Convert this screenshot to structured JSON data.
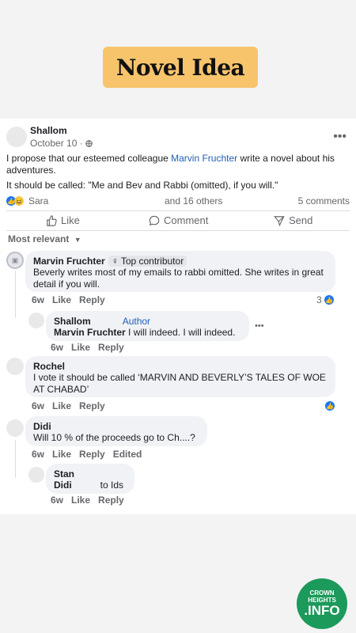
{
  "banner": {
    "title": "Novel Idea"
  },
  "post": {
    "author": "Shallom",
    "date": "October 10 · ",
    "text_before_link": "I propose that our esteemed colleague ",
    "link_name": "Marvin Fruchter",
    "text_after_link": " write a novel about his adventures.",
    "text_line2": "It should be called: \"Me and Bev and Rabbi (omitted), if you will.\"",
    "reactions_name": "Sara",
    "reactions_others": "and 16 others",
    "comments_count": "5 comments"
  },
  "actions": {
    "like": "Like",
    "comment": "Comment",
    "send": "Send"
  },
  "sort_label": "Most relevant",
  "comments": [
    {
      "name": "Marvin Fruchter",
      "badge": "Top contributor",
      "text": "Beverly writes most of my emails to rabbi omitted. She writes in great detail if you will.",
      "time": "6w",
      "like": "Like",
      "reply": "Reply",
      "reaction_count": "3"
    },
    {
      "name": "Shallom",
      "badge": "Author",
      "mention": "Marvin Fruchter",
      "text": "I will indeed. I will indeed.",
      "time": "6w",
      "like": "Like",
      "reply": "Reply"
    },
    {
      "name": "Rochel",
      "text": "I vote it should be called ‘MARVIN AND BEVERLY’S TALES OF WOE AT CHABAD’",
      "time": "6w",
      "like": "Like",
      "reply": "Reply"
    },
    {
      "name": "Didi",
      "text": "Will 10 % of the proceeds go to Ch....?",
      "time": "6w",
      "like": "Like",
      "reply": "Reply",
      "edited": "Edited"
    },
    {
      "name": "Stan",
      "mention": "Didi",
      "text": "to Ids",
      "time": "6w",
      "like": "Like",
      "reply": "Reply"
    }
  ],
  "logo": {
    "line1": "CROWN",
    "line2": "HEIGHTS",
    "line3": ".INFO"
  },
  "colors": {
    "banner": "#f7c46c",
    "link": "#1f5fb5",
    "like_blue": "#1877f2",
    "logo_green": "#1b9a5b"
  }
}
